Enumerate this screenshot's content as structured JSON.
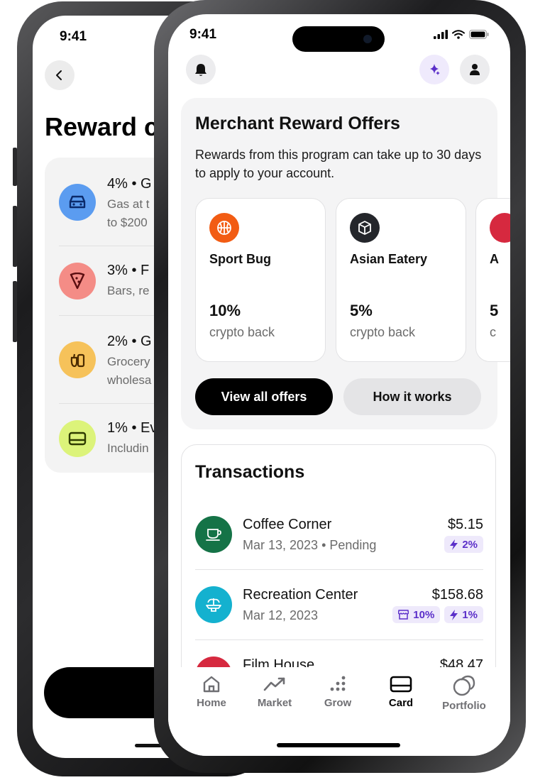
{
  "back_phone": {
    "status_time": "9:41",
    "title": "Reward c",
    "rows": [
      {
        "title": "4% • G",
        "sub1": "Gas at t",
        "sub2": "to $200",
        "color": "#5b9cf0",
        "icon": "car-icon"
      },
      {
        "title": "3% • F",
        "sub1": "Bars, re",
        "sub2": "",
        "color": "#f48c86",
        "icon": "pizza-icon"
      },
      {
        "title": "2% • G",
        "sub1": "Grocery",
        "sub2": "wholesa",
        "color": "#f6c25a",
        "icon": "grocery-icon"
      },
      {
        "title": "1% • Ev",
        "sub1": "Includin",
        "sub2": "",
        "color": "#dcf37a",
        "icon": "card-icon"
      }
    ]
  },
  "status": {
    "time": "9:41"
  },
  "offers": {
    "title": "Merchant Reward Offers",
    "description": "Rewards from this program can take up to 30 days to apply to your account.",
    "items": [
      {
        "name": "Sport Bug",
        "percent": "10%",
        "label": "crypto back",
        "color": "#f25c13",
        "icon": "basketball-icon"
      },
      {
        "name": "Asian Eatery",
        "percent": "5%",
        "label": "crypto back",
        "color": "#24262b",
        "icon": "box-icon"
      },
      {
        "name": "A",
        "percent": "5",
        "label": "c",
        "color": "#d6293f",
        "icon": "merchant-icon"
      }
    ],
    "view_all_label": "View all offers",
    "how_it_works_label": "How it works"
  },
  "transactions": {
    "title": "Transactions",
    "items": [
      {
        "name": "Coffee Corner",
        "date": "Mar 13, 2023 • Pending",
        "amount": "$5.15",
        "color": "#157347",
        "icon": "coffee-icon",
        "badges": [
          {
            "icon": "bolt-icon",
            "text": "2%"
          }
        ]
      },
      {
        "name": "Recreation Center",
        "date": "Mar 12, 2023",
        "amount": "$158.68",
        "color": "#14b1cf",
        "icon": "fountain-icon",
        "badges": [
          {
            "icon": "store-icon",
            "text": "10%"
          },
          {
            "icon": "bolt-icon",
            "text": "1%"
          }
        ]
      },
      {
        "name": "Film House",
        "date": "",
        "amount": "$48.47",
        "color": "#d6293f",
        "icon": "film-icon",
        "badges": []
      }
    ]
  },
  "tabs": [
    {
      "label": "Home",
      "icon": "home-icon",
      "active": false
    },
    {
      "label": "Market",
      "icon": "trend-icon",
      "active": false
    },
    {
      "label": "Grow",
      "icon": "dots-icon",
      "active": false
    },
    {
      "label": "Card",
      "icon": "card-icon",
      "active": true
    },
    {
      "label": "Portfolio",
      "icon": "coins-icon",
      "active": false
    }
  ],
  "colors": {
    "accent": "#5b2fc9",
    "badge_bg": "#eee9fb"
  }
}
